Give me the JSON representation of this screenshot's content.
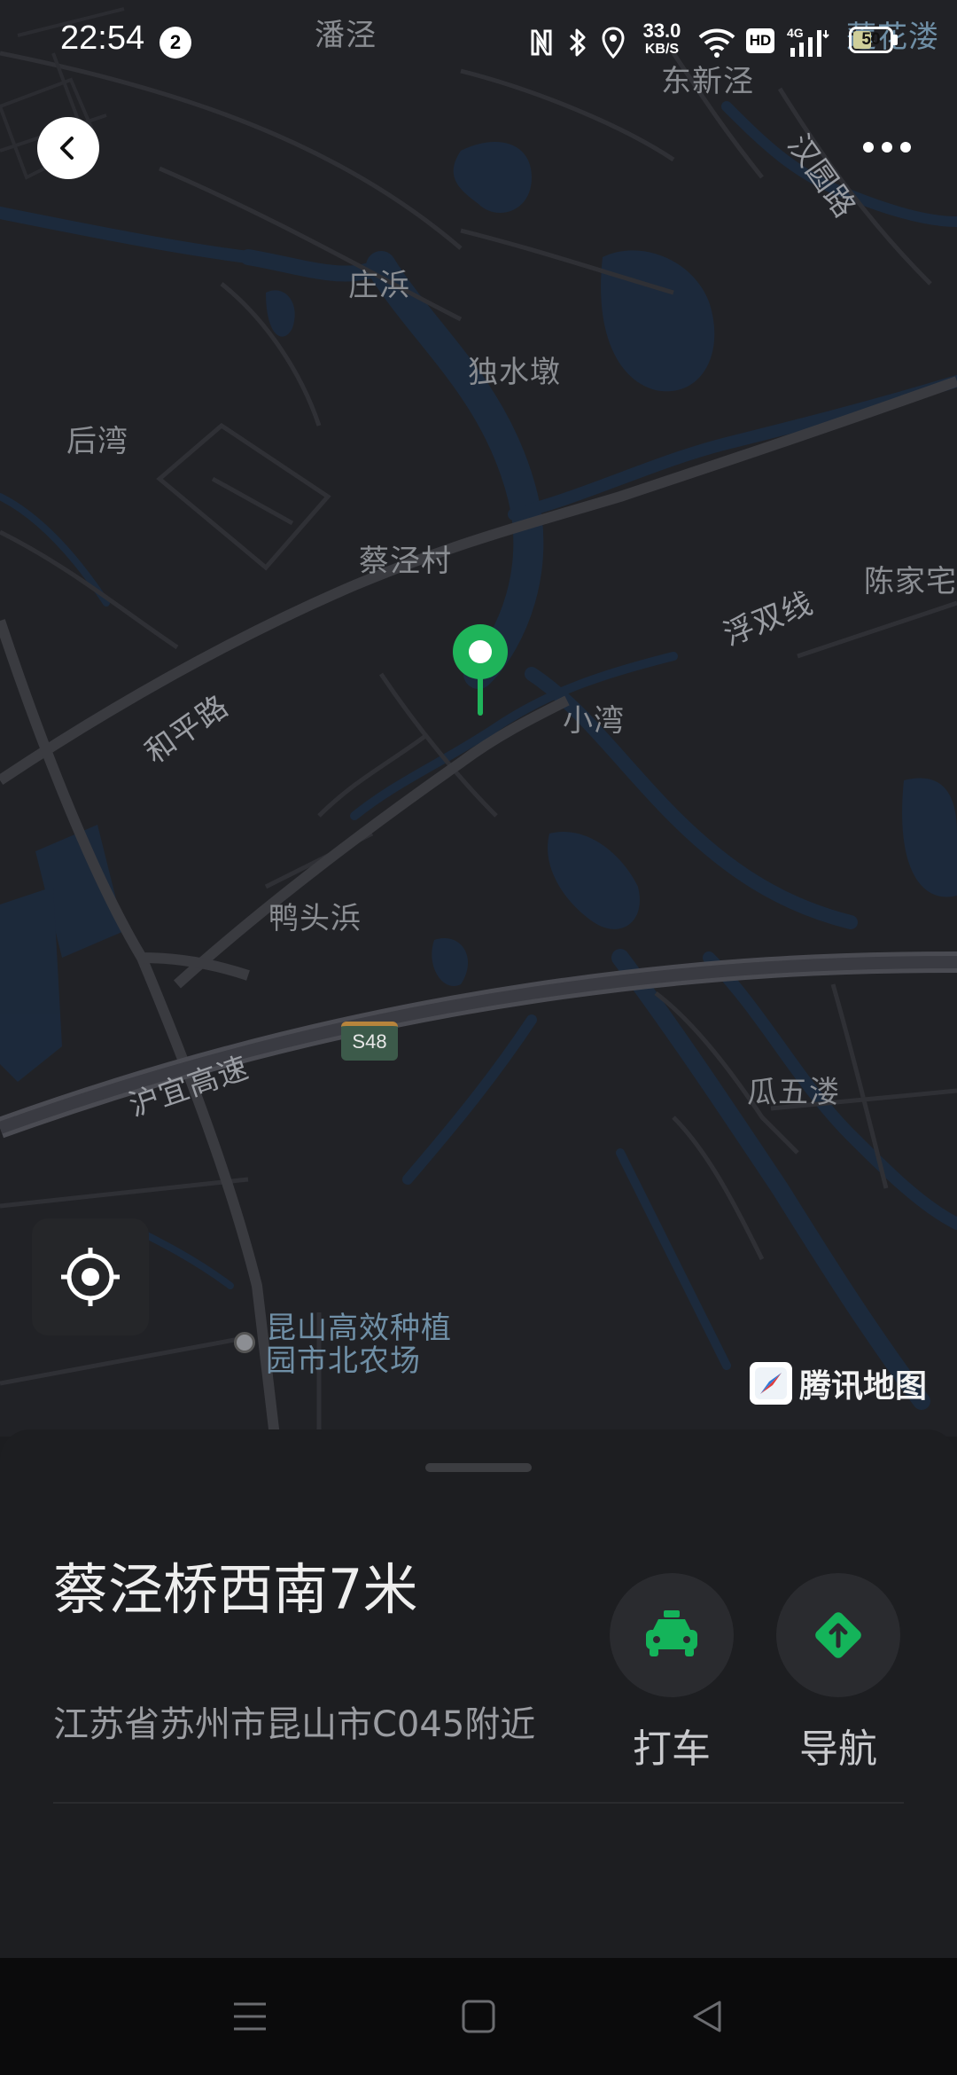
{
  "status_bar": {
    "time": "22:54",
    "notification_count": "2",
    "net_speed_value": "33.0",
    "net_speed_unit": "KB/S",
    "hd_label": "HD",
    "network_type": "4G",
    "battery_level": "50",
    "icons": [
      "nfc-icon",
      "bluetooth-icon",
      "location-icon",
      "wifi-icon",
      "signal-icon"
    ]
  },
  "map": {
    "place_labels": {
      "panjing": "潘泾",
      "dongxinjing": "东新泾",
      "hanyuanlu": "汉圆路",
      "zhuangbang": "庄浜",
      "dushuidun": "独水墩",
      "houwan": "后湾",
      "caijingcun": "蔡泾村",
      "chenjiazhai": "陈家宅",
      "fushuangxian": "浮双线",
      "heping_lu": "和平路",
      "xiaowan": "小湾",
      "yatoubang": "鸭头浜",
      "huyi_gaosu": "沪宜高速",
      "guawulou": "瓜五溇",
      "poi_line1": "昆山高效种植",
      "poi_line2": "园市北农场",
      "top_right_partial": "莲花溇"
    },
    "route_shield": "S48",
    "brand_name": "腾讯地图",
    "pin_color": "#1fb45a"
  },
  "sheet": {
    "title": "蔡泾桥西南7米",
    "address": "江苏省苏州市昆山市C045附近",
    "actions": {
      "taxi_label": "打车",
      "navigate_label": "导航"
    },
    "accent_color": "#14b45a"
  }
}
